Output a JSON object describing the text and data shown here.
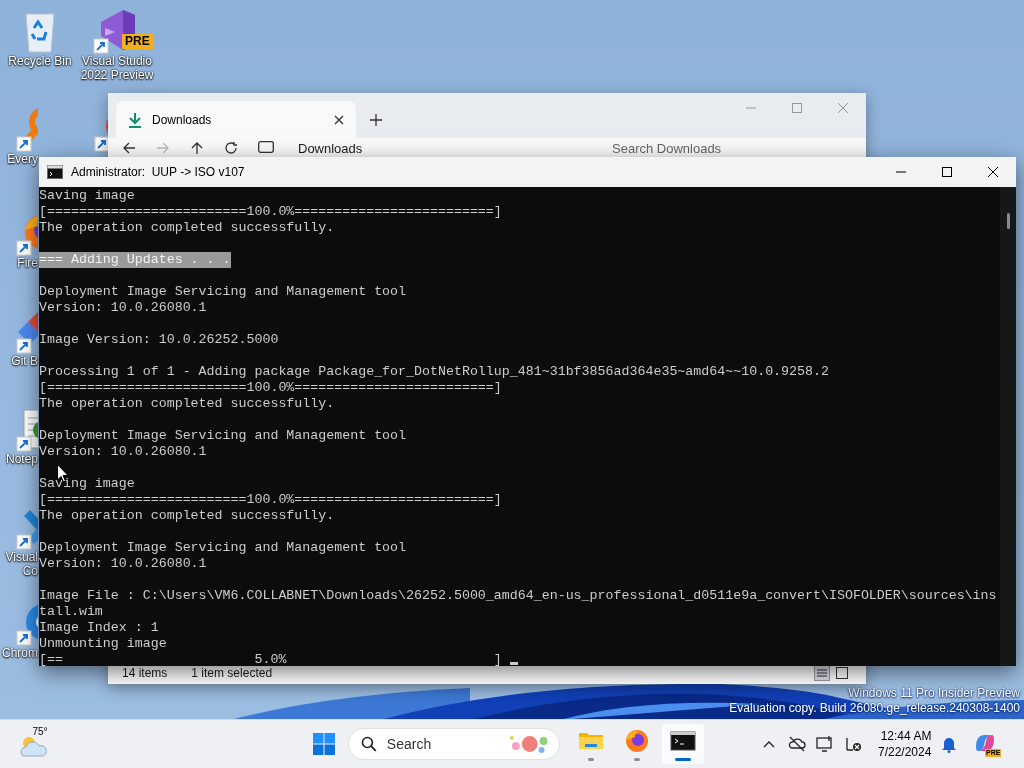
{
  "desktop": {
    "icons": [
      {
        "kind": "recycle-bin",
        "label": [
          "Recycle Bin"
        ],
        "shortcut": false
      },
      {
        "kind": "visual-studio",
        "label": [
          "Visual Studio",
          "2022 Preview"
        ],
        "badge": "PRE",
        "shortcut": true
      },
      {
        "kind": "magnifier",
        "label": [
          "Every"
        ],
        "shortcut": true
      },
      {
        "kind": "ring",
        "shortcut": true
      },
      {
        "kind": "firefox",
        "label": [
          "Fire"
        ],
        "shortcut": true
      },
      {
        "kind": "git",
        "label": [
          "Git B"
        ],
        "shortcut": true
      },
      {
        "kind": "notepad",
        "label": [
          "Notep"
        ],
        "shortcut": true
      },
      {
        "kind": "vscode",
        "label": [
          "Visual",
          "Co"
        ],
        "shortcut": true
      },
      {
        "kind": "chrome",
        "label": [
          "Chrom"
        ],
        "shortcut": true
      }
    ],
    "watermark": [
      "Windows 11 Pro Insider Preview",
      "Evaluation copy. Build 26080.ge_release.240308-1400"
    ]
  },
  "explorer": {
    "tabs": [
      {
        "label": "Downloads",
        "selected": true
      }
    ],
    "address": "Downloads",
    "search": {
      "placeholder": "Search Downloads"
    },
    "status": [
      "14 items",
      "1 item selected"
    ]
  },
  "console": {
    "title": "Administrator:  UUP -> ISO v107",
    "lines": [
      {
        "kind": "text",
        "text": "Saving image",
        "selected": false
      },
      {
        "kind": "text",
        "text": "[=========================100.0%=========================]",
        "selected": false
      },
      {
        "kind": "text",
        "text": "The operation completed successfully.",
        "selected": false
      },
      {
        "kind": "blank"
      },
      {
        "kind": "text",
        "text": "=== Adding Updates . . .",
        "selected": true
      },
      {
        "kind": "blank"
      },
      {
        "kind": "text",
        "text": "Deployment Image Servicing and Management tool",
        "selected": false
      },
      {
        "kind": "text",
        "text": "Version: 10.0.26080.1",
        "selected": false
      },
      {
        "kind": "blank"
      },
      {
        "kind": "text",
        "text": "Image Version: 10.0.26252.5000",
        "selected": false
      },
      {
        "kind": "blank"
      },
      {
        "kind": "text",
        "text": "Processing 1 of 1 - Adding package Package_for_DotNetRollup_481~31bf3856ad364e35~amd64~~10.0.9258.2",
        "selected": false
      },
      {
        "kind": "text",
        "text": "[=========================100.0%=========================]",
        "selected": false
      },
      {
        "kind": "text",
        "text": "The operation completed successfully.",
        "selected": false
      },
      {
        "kind": "blank"
      },
      {
        "kind": "text",
        "text": "Deployment Image Servicing and Management tool",
        "selected": false
      },
      {
        "kind": "text",
        "text": "Version: 10.0.26080.1",
        "selected": false
      },
      {
        "kind": "blank"
      },
      {
        "kind": "text",
        "text": "Saving image",
        "selected": false
      },
      {
        "kind": "text",
        "text": "[=========================100.0%=========================]",
        "selected": false
      },
      {
        "kind": "text",
        "text": "The operation completed successfully.",
        "selected": false
      },
      {
        "kind": "blank"
      },
      {
        "kind": "text",
        "text": "Deployment Image Servicing and Management tool",
        "selected": false
      },
      {
        "kind": "text",
        "text": "Version: 10.0.26080.1",
        "selected": false
      },
      {
        "kind": "blank"
      },
      {
        "kind": "text",
        "text": "Image File : C:\\Users\\VM6.COLLABNET\\Downloads\\26252.5000_amd64_en-us_professional_d0511e9a_convert\\ISOFOLDER\\sources\\ins",
        "selected": false
      },
      {
        "kind": "text",
        "text": "tall.wim",
        "selected": false
      },
      {
        "kind": "text",
        "text": "Image Index : 1",
        "selected": false
      },
      {
        "kind": "text",
        "text": "Unmounting image",
        "selected": false
      },
      {
        "kind": "text",
        "text": "[==                        5.0%                          ]",
        "selected": false
      }
    ]
  },
  "taskbar": {
    "weather": {
      "temp": "75°"
    },
    "search": {
      "label": "Search"
    },
    "apps": [
      {
        "kind": "files",
        "selected": false
      },
      {
        "kind": "firefox",
        "selected": false
      },
      {
        "kind": "terminal",
        "selected": true
      }
    ],
    "tray": [
      {
        "kind": "chevron"
      },
      {
        "kind": "cloud-off"
      },
      {
        "kind": "display"
      },
      {
        "kind": "network"
      }
    ],
    "clock": {
      "time": "12:44 AM",
      "date": "7/22/2024"
    },
    "copilot": {
      "badge": "PRE"
    }
  }
}
